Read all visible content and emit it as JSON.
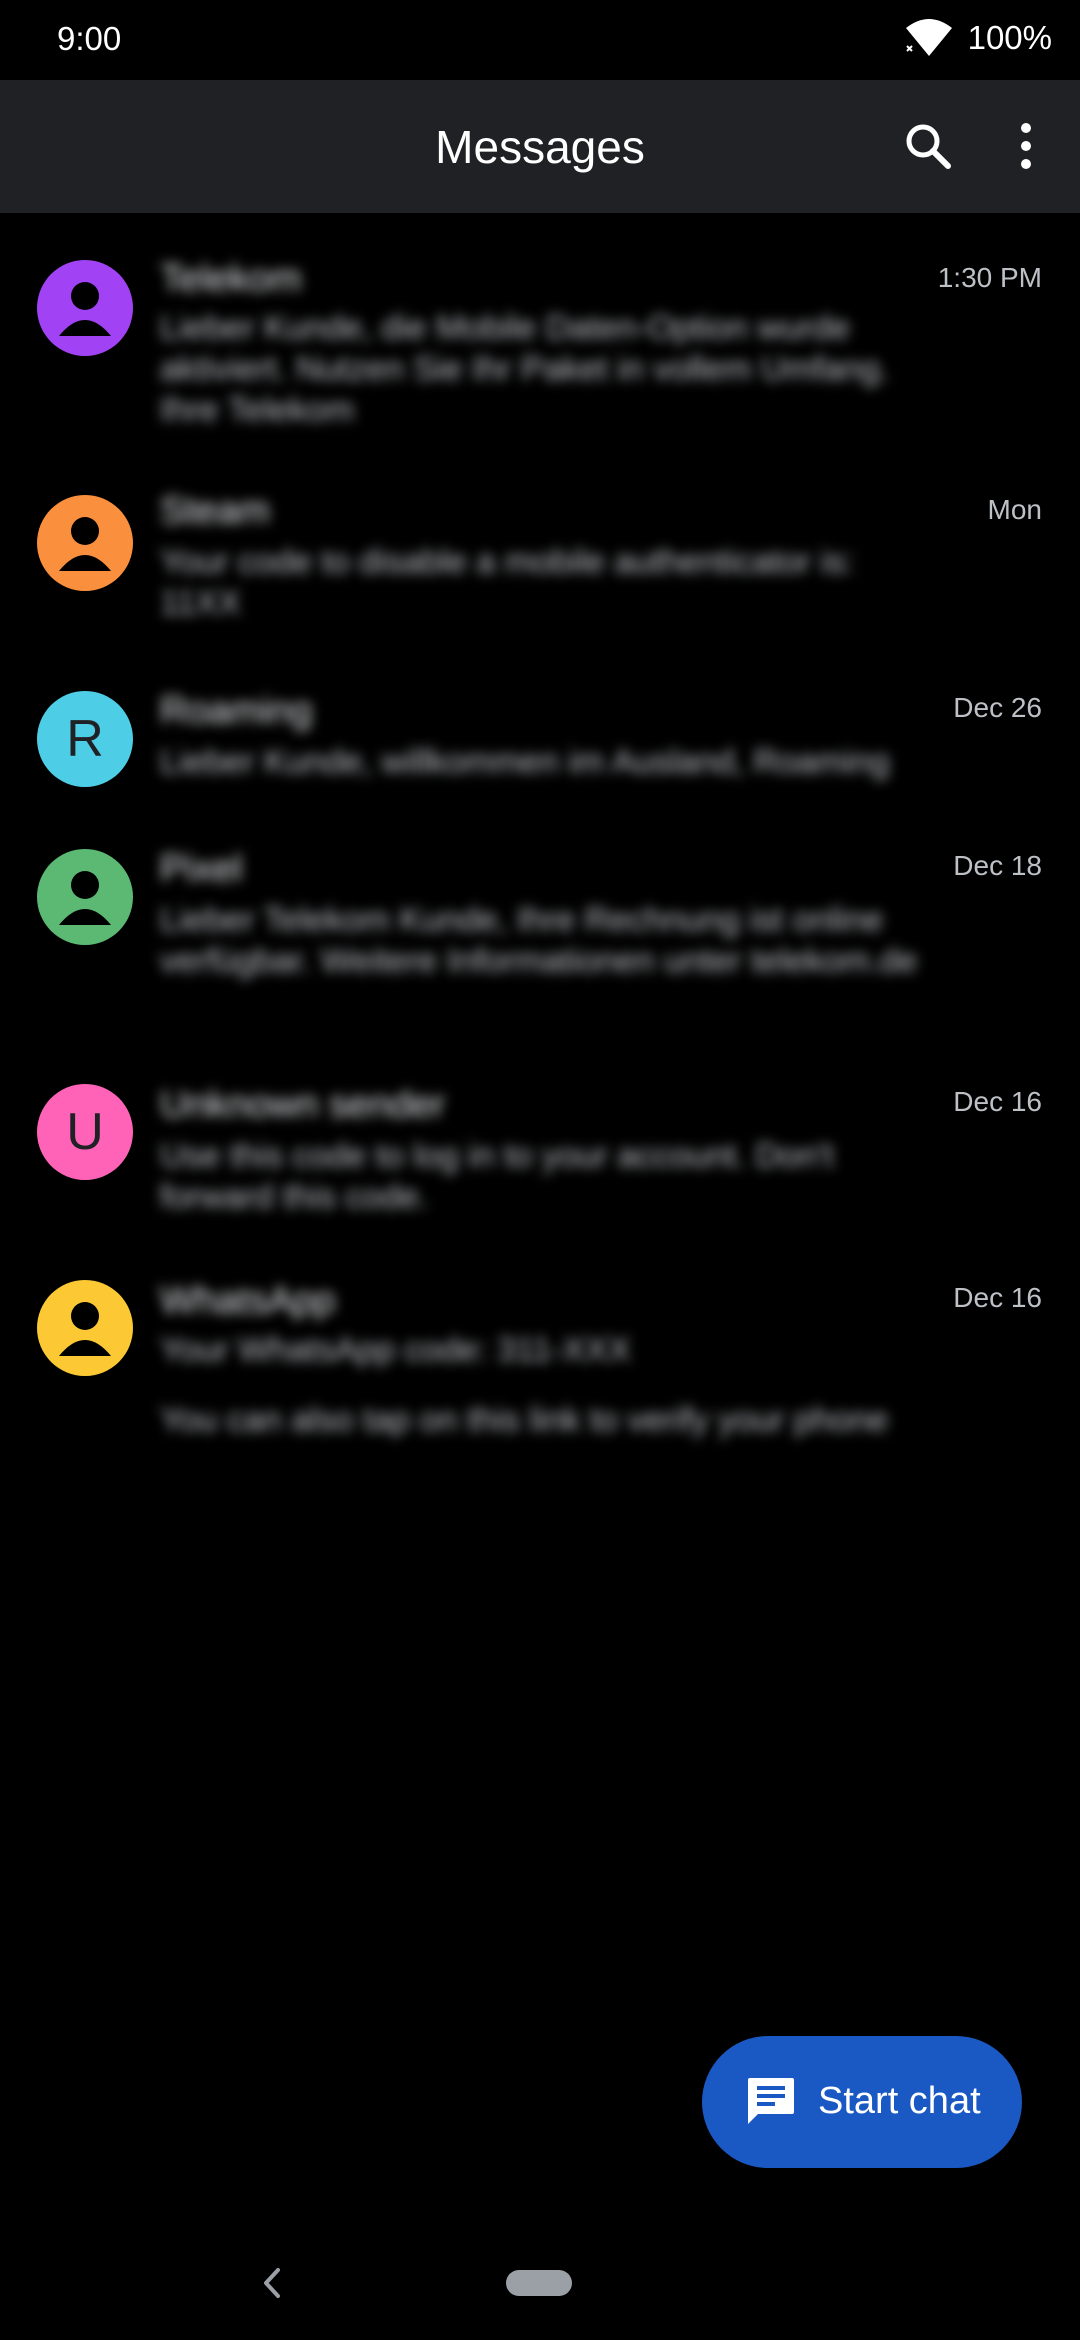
{
  "status_bar": {
    "time": "9:00",
    "battery": "100%"
  },
  "app_bar": {
    "title": "Messages",
    "search_icon": "search-icon",
    "more_icon": "more-vert-icon"
  },
  "conversations": [
    {
      "name": "Telekom",
      "time": "1:30 PM",
      "avatar_type": "person-icon",
      "avatar_color": "#a142f4",
      "snippet": "Lieber Kunde, die Mobile Daten-Option wurde aktiviert. Nutzen Sie Ihr Paket in vollem Umfang. Ihre Telekom"
    },
    {
      "name": "Steam",
      "time": "Mon",
      "avatar_type": "person-icon",
      "avatar_color": "#fa903e",
      "snippet": "Your code to disable a mobile authenticator is: 11XX"
    },
    {
      "name": "Roaming",
      "time": "Dec 26",
      "avatar_type": "letter",
      "letter": "R",
      "avatar_color": "#4ecde6",
      "snippet": "Lieber Kunde, willkommen im Ausland, Roaming"
    },
    {
      "name": "Pixel",
      "time": "Dec 18",
      "avatar_type": "person-icon",
      "avatar_color": "#5bb974",
      "snippet": "Lieber Telekom Kunde, Ihre Rechnung ist online verfügbar. Weitere Informationen unter telekom.de"
    },
    {
      "name": "Unknown sender",
      "time": "Dec 16",
      "avatar_type": "letter",
      "letter": "U",
      "avatar_color": "#ff63b8",
      "snippet": "Use this code to log in to your account. Don't forward this code."
    },
    {
      "name": "WhatsApp",
      "time": "Dec 16",
      "avatar_type": "person-icon",
      "avatar_color": "#fcc934",
      "snippet": "Your WhatsApp code: 311-XXX",
      "snippet2": "You can also tap on this link to verify your phone"
    }
  ],
  "fab": {
    "label": "Start chat",
    "icon": "chat-icon"
  },
  "nav": {
    "back_icon": "back-icon",
    "home_icon": "home-pill"
  }
}
